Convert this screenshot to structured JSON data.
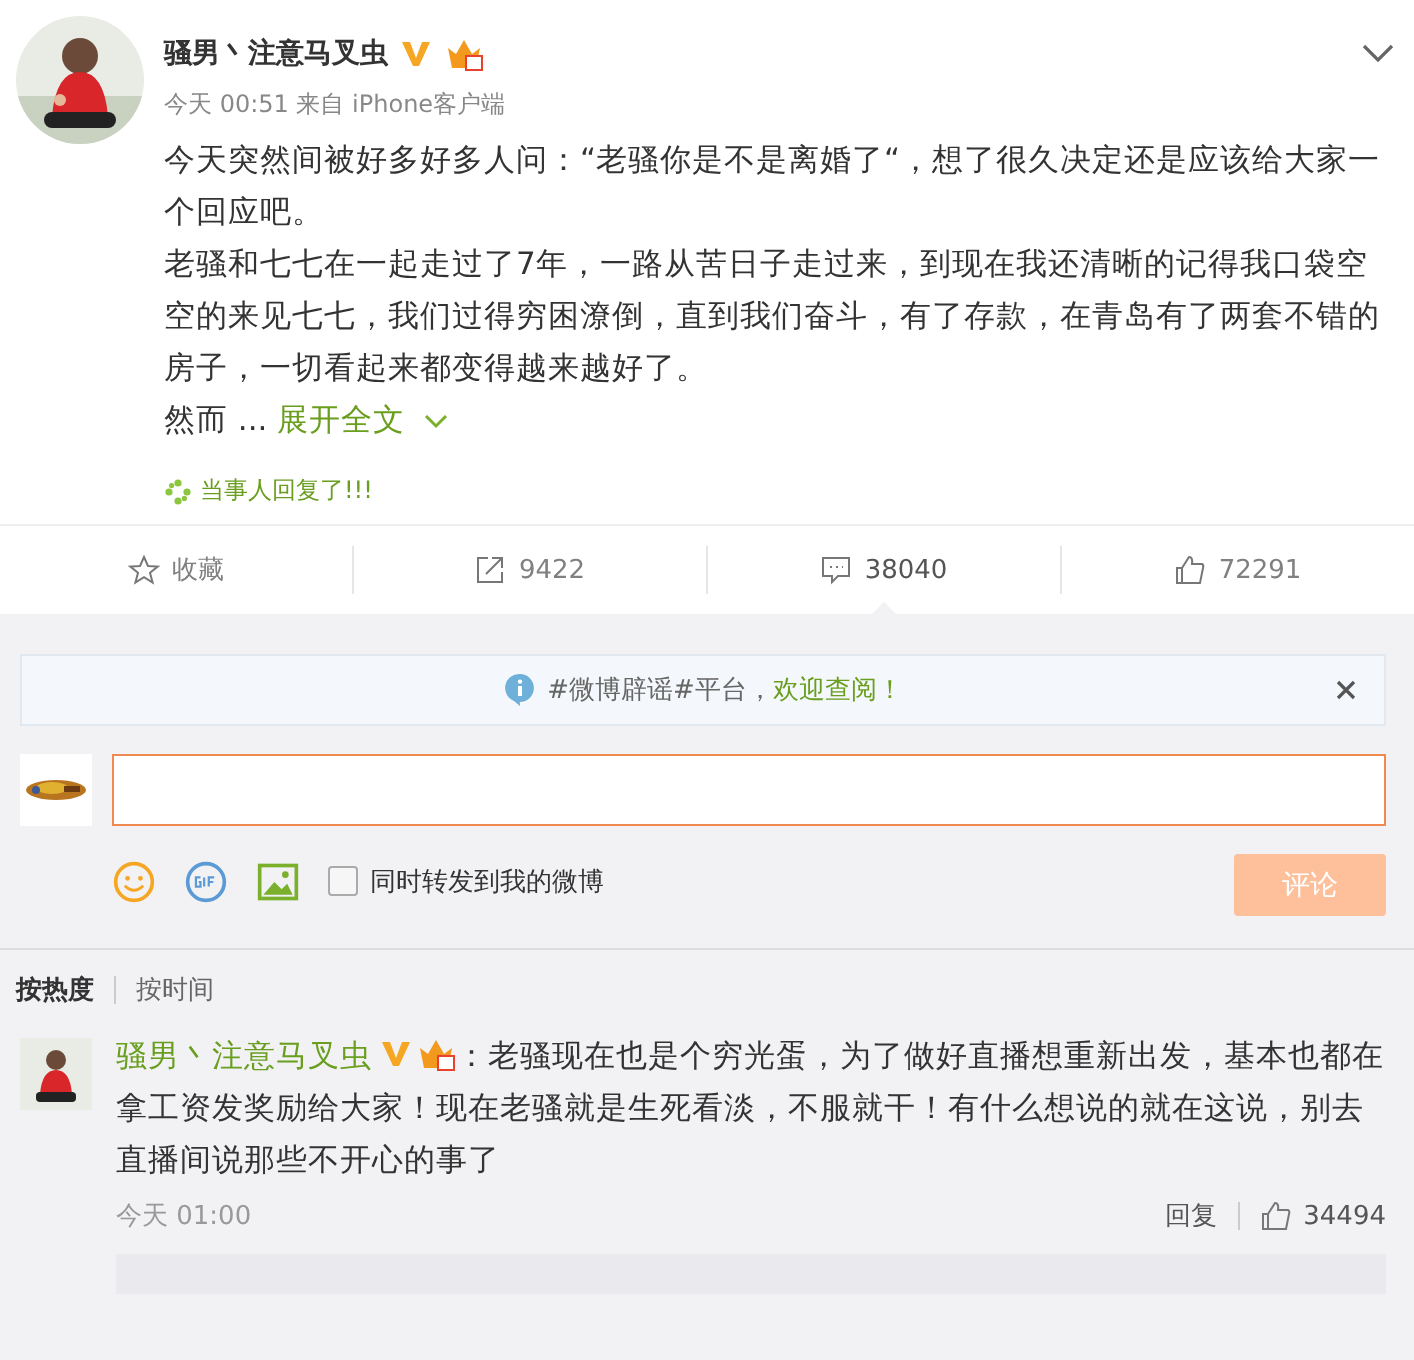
{
  "post": {
    "author": "骚男丶注意马叉虫",
    "verified": true,
    "time": "今天 00:51",
    "source": "来自 iPhone客户端",
    "paragraphs": [
      "今天突然间被好多好多人问：“老骚你是不是离婚了“，想了很久决定还是应该给大家一个回应吧。",
      "老骚和七七在一起走过了7年，一路从苦日子走过来，到现在我还清晰的记得我口袋空空的来见七七，我们过得穷困潦倒，直到我们奋斗，有了存款，在青岛有了两套不错的房子，一切看起来都变得越来越好了。"
    ],
    "teaser": "然而 ...",
    "expand_link": "展开全文",
    "reply_notice": "当事人回复了!!!"
  },
  "actions": [
    {
      "kind": "favorite",
      "label": "收藏",
      "selected": false
    },
    {
      "kind": "repost",
      "label": "9422",
      "selected": false
    },
    {
      "kind": "comment",
      "label": "38040",
      "selected": true
    },
    {
      "kind": "like",
      "label": "72291",
      "selected": false
    }
  ],
  "notice": {
    "text": "#微博辟谣#平台，",
    "link": "欢迎查阅！"
  },
  "composer": {
    "repost_label": "同时转发到我的微博",
    "repost_checked": false,
    "submit": "评论"
  },
  "sort_tabs": [
    {
      "label": "按热度",
      "selected": true
    },
    {
      "label": "按时间",
      "selected": false
    }
  ],
  "comments": [
    {
      "author": "骚男丶注意马叉虫",
      "verified": true,
      "text": "：老骚现在也是个穷光蛋，为了做好直播想重新出发，基本也都在拿工资发奖励给大家！现在老骚就是生死看淡，不服就干！有什么想说的就在这说，别去直播间说那些不开心的事了",
      "time": "今天 01:00",
      "reply": "回复",
      "likes": "34494"
    }
  ]
}
